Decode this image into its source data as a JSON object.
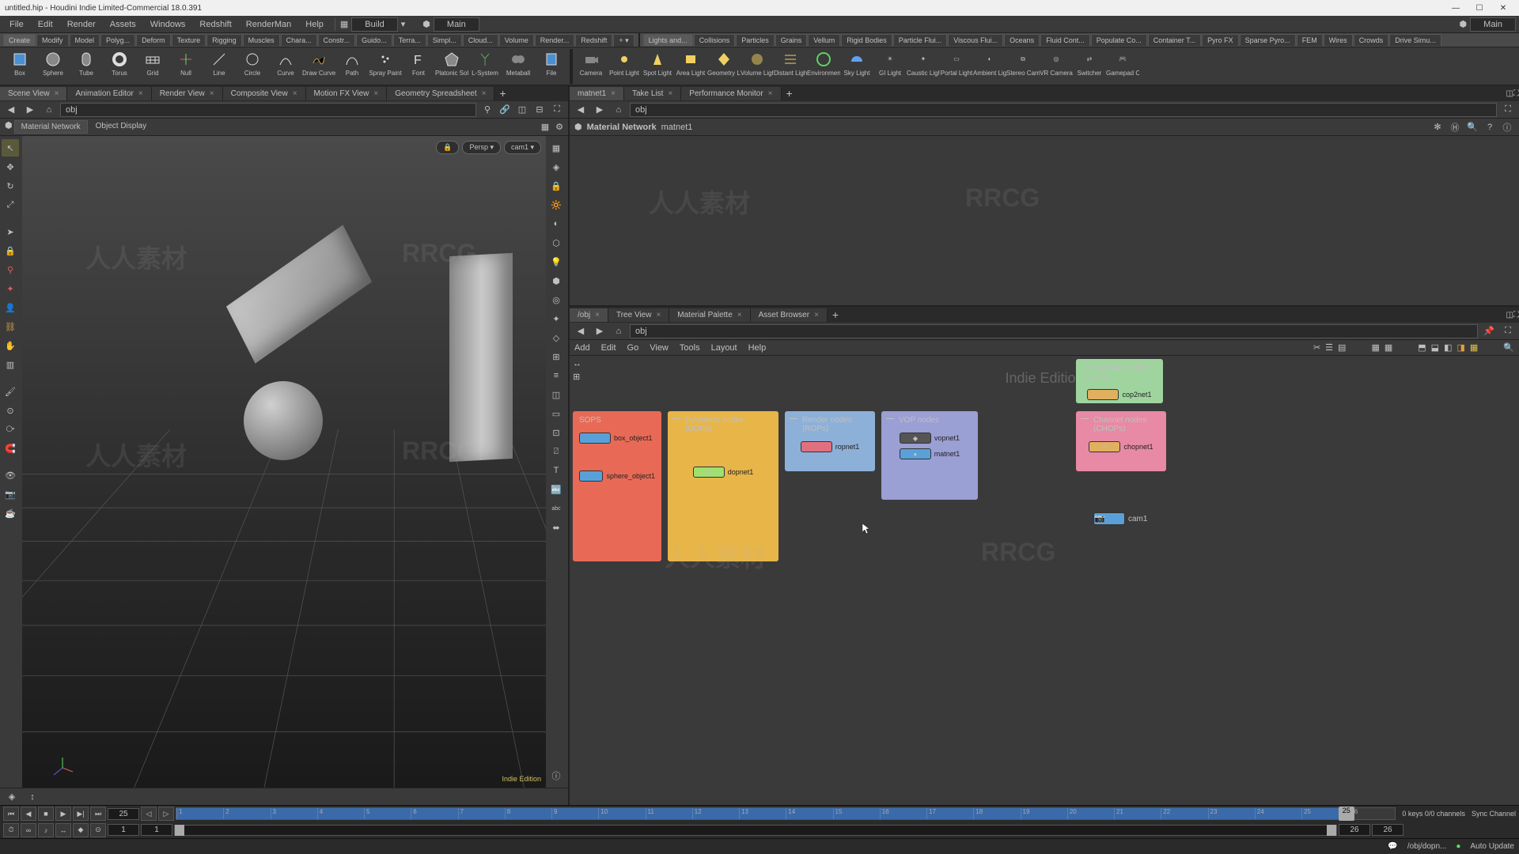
{
  "title": "untitled.hip - Houdini Indie Limited-Commercial 18.0.391",
  "menus": [
    "File",
    "Edit",
    "Render",
    "Assets",
    "Windows",
    "Redshift",
    "RenderMan",
    "Help"
  ],
  "desktop_label": "Build",
  "path_label": "Main",
  "shelf_tabs_left": [
    "Create",
    "Modify",
    "Model",
    "Polyg...",
    "Deform",
    "Texture",
    "Rigging",
    "Muscles",
    "Chara...",
    "Constr...",
    "Guido...",
    "Terra...",
    "Simpl...",
    "Cloud...",
    "Volume",
    "Render...",
    "Redshift"
  ],
  "shelf_tabs_right": [
    "Lights and...",
    "Collisions",
    "Particles",
    "Grains",
    "Vellum",
    "Rigid Bodies",
    "Particle Flui...",
    "Viscous Flui...",
    "Oceans",
    "Fluid Cont...",
    "Populate Co...",
    "Container T...",
    "Pyro FX",
    "Sparse Pyro...",
    "FEM",
    "Wires",
    "Crowds",
    "Drive Simu..."
  ],
  "shelf_tools_left": [
    {
      "name": "Box"
    },
    {
      "name": "Sphere"
    },
    {
      "name": "Tube"
    },
    {
      "name": "Torus"
    },
    {
      "name": "Grid"
    },
    {
      "name": "Null"
    },
    {
      "name": "Line"
    },
    {
      "name": "Circle"
    },
    {
      "name": "Curve"
    },
    {
      "name": "Draw Curve"
    },
    {
      "name": "Path"
    },
    {
      "name": "Spray Paint"
    },
    {
      "name": "Font"
    },
    {
      "name": "Platonic Solids"
    },
    {
      "name": "L-System"
    },
    {
      "name": "Metaball"
    },
    {
      "name": "File"
    }
  ],
  "shelf_tools_right": [
    {
      "name": "Camera"
    },
    {
      "name": "Point Light"
    },
    {
      "name": "Spot Light"
    },
    {
      "name": "Area Light"
    },
    {
      "name": "Geometry Light"
    },
    {
      "name": "Volume Light"
    },
    {
      "name": "Distant Light"
    },
    {
      "name": "Environment Light"
    },
    {
      "name": "Sky Light"
    },
    {
      "name": "GI Light"
    },
    {
      "name": "Caustic Light"
    },
    {
      "name": "Portal Light"
    },
    {
      "name": "Ambient Light"
    },
    {
      "name": "Stereo Camera"
    },
    {
      "name": "VR Camera"
    },
    {
      "name": "Switcher"
    },
    {
      "name": "Gamepad Camera"
    }
  ],
  "left_tabs": [
    "Scene View",
    "Animation Editor",
    "Render View",
    "Composite View",
    "Motion FX View",
    "Geometry Spreadsheet"
  ],
  "right_upper_tabs": [
    "matnet1",
    "Take List",
    "Performance Monitor"
  ],
  "right_lower_tabs": [
    "/obj",
    "Tree View",
    "Material Palette",
    "Asset Browser"
  ],
  "obj_path": "obj",
  "vp_header": {
    "mat_network": "Material Network",
    "object_display": "Object Display"
  },
  "vp_camera_pills": {
    "lock": "🔒",
    "persp": "Persp ▾",
    "cam": "cam1 ▾"
  },
  "vp_edition": "Indie Edition",
  "upper_net": {
    "title": "Material Network",
    "context": "matnet1"
  },
  "lower_net_menus": [
    "Add",
    "Edit",
    "Go",
    "View",
    "Tools",
    "Layout",
    "Help"
  ],
  "netboxes": {
    "sops": {
      "title": "SOPS",
      "items": [
        "box_object1",
        "sphere_object1"
      ]
    },
    "dops": {
      "title": "Dynamics nodes (DOPs)",
      "items": [
        "dopnet1"
      ]
    },
    "rops": {
      "title": "Render nodes (ROPs)",
      "items": [
        "ropnet1"
      ]
    },
    "vops": {
      "title": "VOP nodes",
      "items": [
        "vopnet1",
        "matnet1"
      ]
    },
    "cops": {
      "title": "Compositing nodes (COPs)",
      "items": [
        "cop2net1"
      ]
    },
    "chops": {
      "title": "Channel nodes (CHOPs)",
      "items": [
        "chopnet1"
      ]
    }
  },
  "cam_node": "cam1",
  "edition_overlay": "Indie Edition",
  "timeline": {
    "current": "25",
    "marker": "25",
    "start": "1",
    "range_start": "1",
    "end": "26",
    "range_end": "26",
    "ticks": [
      "1",
      "2",
      "3",
      "4",
      "5",
      "6",
      "7",
      "8",
      "9",
      "10",
      "11",
      "12",
      "13",
      "14",
      "15",
      "16",
      "17",
      "18",
      "19",
      "20",
      "21",
      "22",
      "23",
      "24",
      "25",
      "26"
    ],
    "keys_status": "0 keys  0/0 channels",
    "sync": "Sync Channel"
  },
  "status": {
    "path": "/obj/dopn...",
    "update": "Auto Update"
  },
  "watermark": "人人素材 RRCG"
}
